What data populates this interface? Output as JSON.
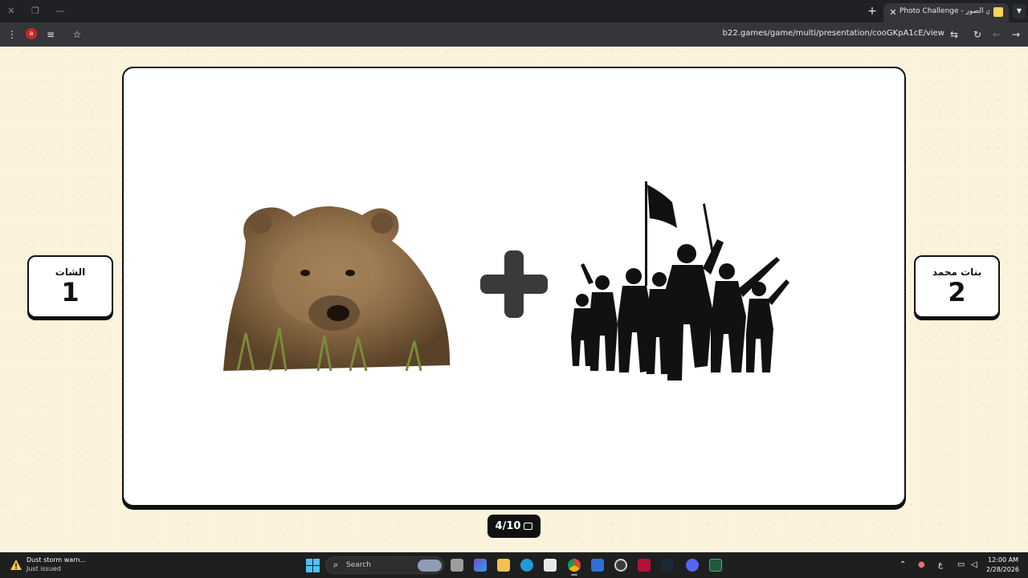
{
  "browser": {
    "tab_title": "Photo Challenge - تحدي الصور",
    "url": "b22.games/game/multi/presentation/cooGKpA1cE/view",
    "profile_initial": "a",
    "new_tab_glyph": "+",
    "tab_close_glyph": "✕",
    "icons": [
      "minimize-icon",
      "restore-icon",
      "close-window-icon",
      "menu-icon",
      "reading-list-icon",
      "bookmark-star-icon",
      "site-settings-icon",
      "reload-icon",
      "back-icon",
      "forward-icon"
    ]
  },
  "game": {
    "team_left": {
      "name": "الشات",
      "score": "1"
    },
    "team_right": {
      "name": "بنات محمد",
      "score": "2"
    },
    "counter": "4/10",
    "puzzle_images": [
      "bear-image",
      "plus-sign",
      "soldiers-silhouette-image"
    ]
  },
  "taskbar": {
    "weather_title": "Dust storm warn...",
    "weather_sub": "Just issued",
    "search_label": "Search",
    "input_lang": "ع",
    "time": "12:00 AM",
    "date": "2/28/2026",
    "colors": {
      "accent": "#4cc2ff",
      "bg": "#1f1f1f"
    }
  },
  "theme": {
    "page_bg": "#fbf3dc",
    "card_bg": "#ffffff",
    "ink": "#111111"
  }
}
